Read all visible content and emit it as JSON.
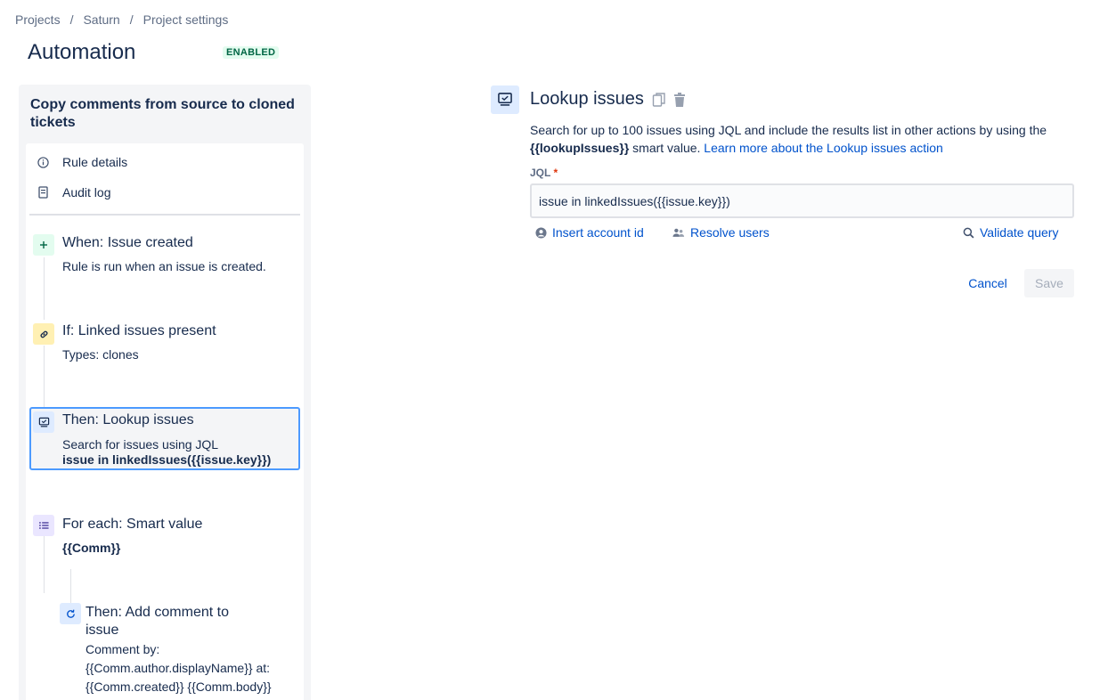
{
  "breadcrumb": [
    "Projects",
    "Saturn",
    "Project settings"
  ],
  "breadcrumb_separator": "/",
  "page": {
    "title": "Automation",
    "status": "ENABLED"
  },
  "rule": {
    "name": "Copy comments from source to cloned tickets",
    "menu": {
      "details": "Rule details",
      "audit": "Audit log"
    },
    "components": [
      {
        "title": "When: Issue created",
        "desc": "Rule is run when an issue is created.",
        "icon": "plus-icon",
        "color": "#e3fcef"
      },
      {
        "title": "If: Linked issues present",
        "desc": "Types: clones",
        "icon": "link-icon",
        "color": "#fff0b3"
      },
      {
        "title": "Then: Lookup issues",
        "desc": "Search for issues using JQL",
        "detail": "issue in linkedIssues({{issue.key}})",
        "icon": "lookup-icon",
        "color": "#deebff"
      },
      {
        "title": "For each: Smart value",
        "detail": "{{Comm}}",
        "icon": "list-icon",
        "color": "#eae6ff"
      },
      {
        "title_line1": "Then: Add comment to",
        "title_line2": "issue",
        "desc_lines": [
          "Comment by:",
          "{{Comm.author.displayName}} at:",
          "{{Comm.created}} {{Comm.body}}"
        ],
        "icon": "refresh-icon",
        "color": "#deebff"
      }
    ]
  },
  "editor": {
    "title": "Lookup issues",
    "desc_part1": "Search for up to 100 issues using JQL and include the results list in other actions by using the",
    "desc_smart": "{{lookupIssues}}",
    "desc_part2": " smart value. ",
    "desc_link": "Learn more about the Lookup issues action",
    "jql_label": "JQL",
    "jql_required": "*",
    "jql_value": "issue in linkedIssues({{issue.key}})",
    "insert_account": "Insert account id",
    "resolve_users": "Resolve users",
    "validate_query": "Validate query",
    "cancel": "Cancel",
    "save": "Save"
  }
}
